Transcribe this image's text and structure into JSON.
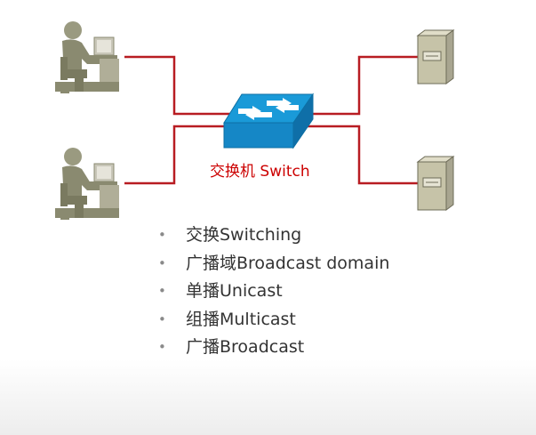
{
  "switch": {
    "label": "交换机 Switch"
  },
  "terms": [
    {
      "text": "交换Switching"
    },
    {
      "text": "广播域Broadcast domain"
    },
    {
      "text": "单播Unicast"
    },
    {
      "text": "组播Multicast"
    },
    {
      "text": "广播Broadcast"
    }
  ],
  "colors": {
    "link": "#b81c22",
    "switch_top": "#1a9ad8",
    "switch_front": "#1587c6",
    "switch_label": "#cc0000",
    "person": "#8a8a70",
    "server": "#c6c3a8"
  }
}
